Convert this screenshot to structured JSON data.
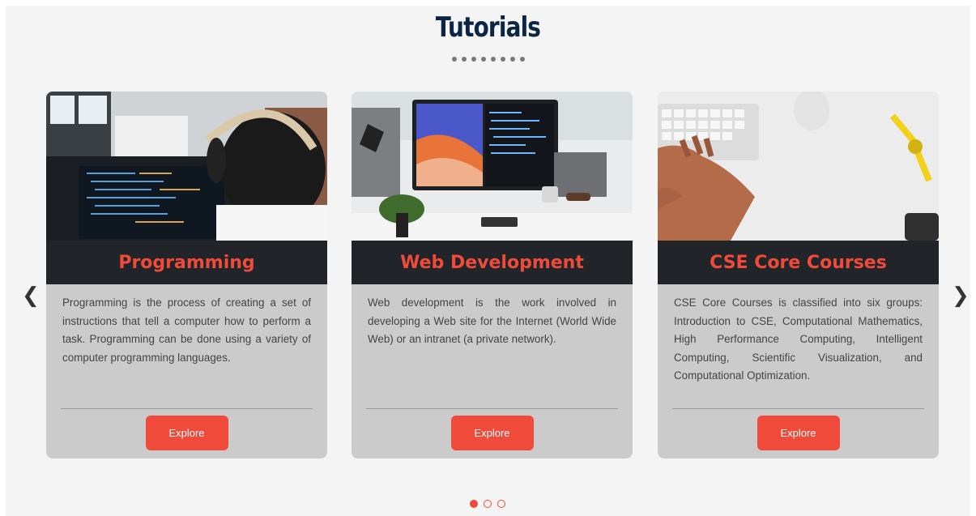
{
  "section": {
    "title": "Tutorials"
  },
  "nav": {
    "prev_label": "❮",
    "next_label": "❯"
  },
  "cards": [
    {
      "title": "Programming",
      "description": "Programming is the process of creating a set of instructions that tell a computer how to perform a task. Programming can be done using a variety of computer programming languages.",
      "button": "Explore"
    },
    {
      "title": "Web Development",
      "description": "Web development is the work involved in developing a Web site for the Internet (World Wide Web) or an intranet (a private network).",
      "button": "Explore"
    },
    {
      "title": "CSE Core Courses",
      "description": "CSE Core Courses is classified into six groups: Introduction to CSE, Computational Mathematics, High Performance Computing, Intelligent Computing, Scientific Visualization, and Computational Optimization.",
      "button": "Explore"
    }
  ],
  "pager": {
    "active_index": 0,
    "count": 3
  },
  "colors": {
    "accent": "#f04a3a",
    "title": "#0b2545",
    "card_bg": "#cbcbcb",
    "card_head": "#212529"
  }
}
